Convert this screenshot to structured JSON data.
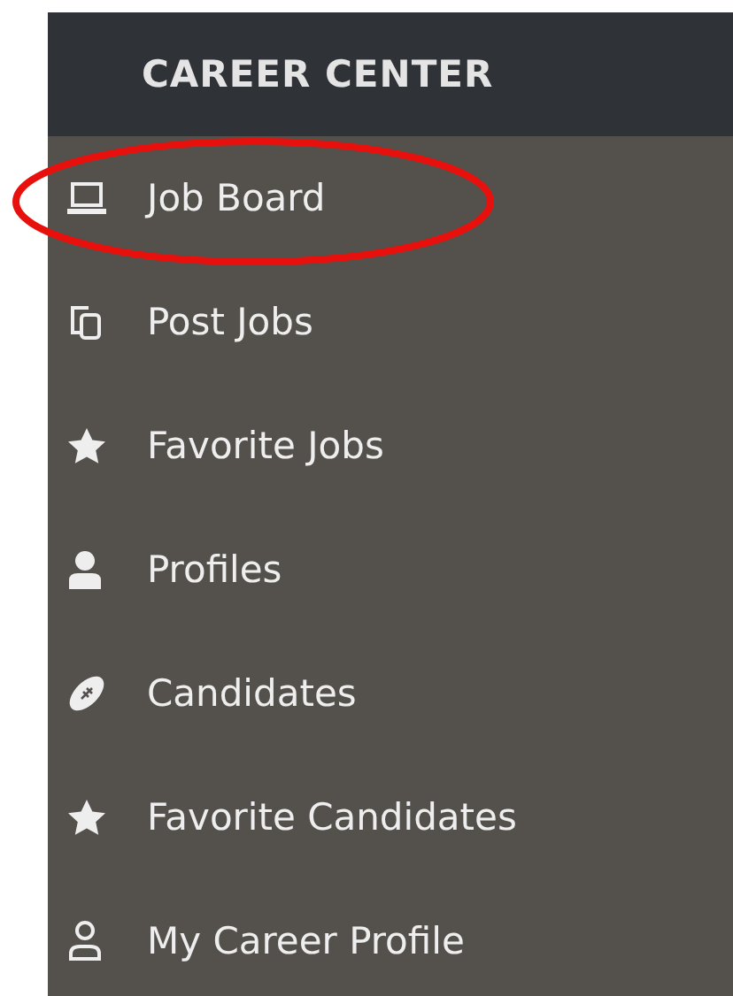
{
  "sidebar": {
    "title": "CAREER CENTER",
    "items": [
      {
        "label": "Job Board",
        "circled": true
      },
      {
        "label": "Post Jobs",
        "circled": false
      },
      {
        "label": "Favorite Jobs",
        "circled": false
      },
      {
        "label": "Profiles",
        "circled": false
      },
      {
        "label": "Candidates",
        "circled": false
      },
      {
        "label": "Favorite Candidates",
        "circled": false
      },
      {
        "label": "My Career Profile",
        "circled": false
      }
    ]
  }
}
